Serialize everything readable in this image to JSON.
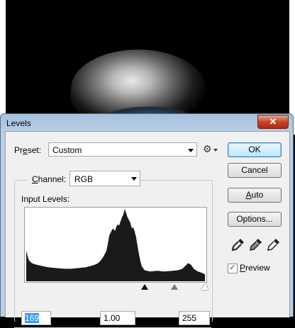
{
  "dialog": {
    "title": "Levels",
    "close_symbol": "✕"
  },
  "preset": {
    "label_prefix": "Pr",
    "label_mnemonic": "e",
    "label_suffix": "set:",
    "value": "Custom"
  },
  "channel": {
    "label_mnemonic": "C",
    "label_suffix": "hannel:",
    "value": "RGB"
  },
  "input_levels": {
    "label": "Input Levels:",
    "black": "169",
    "gamma": "1.00",
    "white": "255"
  },
  "buttons": {
    "ok": "OK",
    "cancel": "Cancel",
    "auto_mnemonic": "A",
    "auto_suffix": "uto",
    "options": "Options..."
  },
  "preview": {
    "checked": "✓",
    "label_mnemonic": "P",
    "label_suffix": "review"
  },
  "colors": {
    "accent": "#3399ff",
    "title_bar": "#b8cfe6",
    "close": "#c8432a"
  },
  "icons": [
    "gear-icon",
    "black-eyedropper-icon",
    "gray-eyedropper-icon",
    "white-eyedropper-icon"
  ]
}
